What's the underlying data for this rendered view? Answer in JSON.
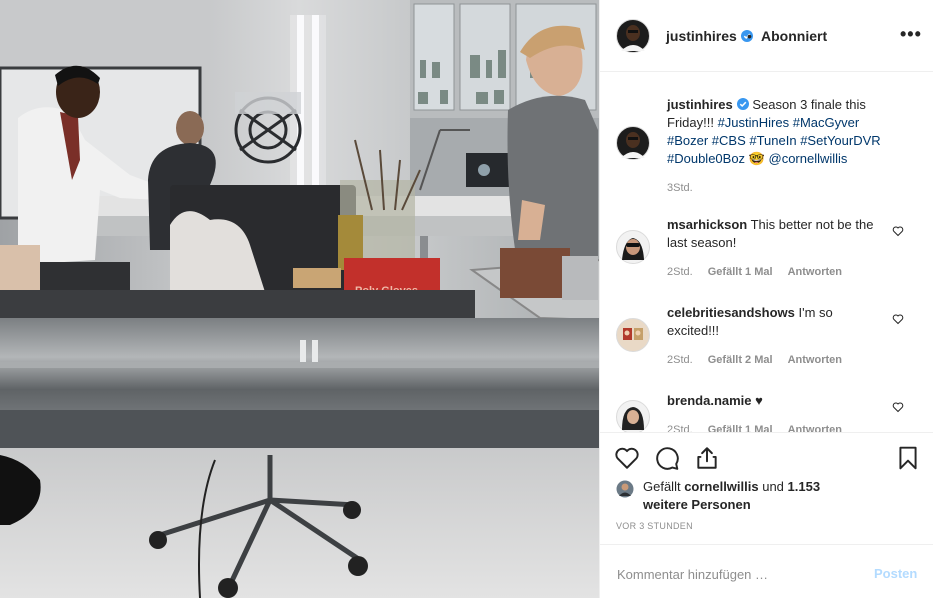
{
  "post": {
    "author": "justinhires",
    "follow_status": "Abonniert",
    "separator": "•",
    "more_label": "•••"
  },
  "caption": {
    "username": "justinhires",
    "text_prefix": "Season 3 finale this Friday!!! ",
    "hashtags": "#JustinHires #MacGyver #Bozer #CBS #TuneIn #SetYourDVR #Double0Boz",
    "emoji": "🤓",
    "mention": "@cornellwillis",
    "time": "3Std."
  },
  "comments": [
    {
      "username": "msarhickson",
      "text": "This better not be the last season!",
      "time": "2Std.",
      "likes": "Gefällt 1 Mal",
      "reply": "Antworten"
    },
    {
      "username": "celebritiesandshows",
      "text": "I'm so excited!!!",
      "time": "2Std.",
      "likes": "Gefällt 2 Mal",
      "reply": "Antworten"
    },
    {
      "username": "brenda.namie",
      "text": "♥",
      "time": "2Std.",
      "likes": "Gefällt 1 Mal",
      "reply": "Antworten"
    }
  ],
  "likes": {
    "prefix": "Gefällt ",
    "user": "cornellwillis",
    "middle": " und ",
    "others": "1.153 weitere Personen"
  },
  "timestamp": "VOR 3 STUNDEN",
  "comment_box": {
    "placeholder": "Kommentar hinzufügen …",
    "submit_label": "Posten"
  },
  "photo": {
    "box_label": "Poly Gloves"
  },
  "colors": {
    "link": "#00376b",
    "verified": "#3897f0",
    "post_disabled": "#b3dbff"
  },
  "icons": [
    "verified-badge-icon",
    "more-options-icon",
    "heart-icon",
    "comment-icon",
    "share-icon",
    "bookmark-icon"
  ]
}
